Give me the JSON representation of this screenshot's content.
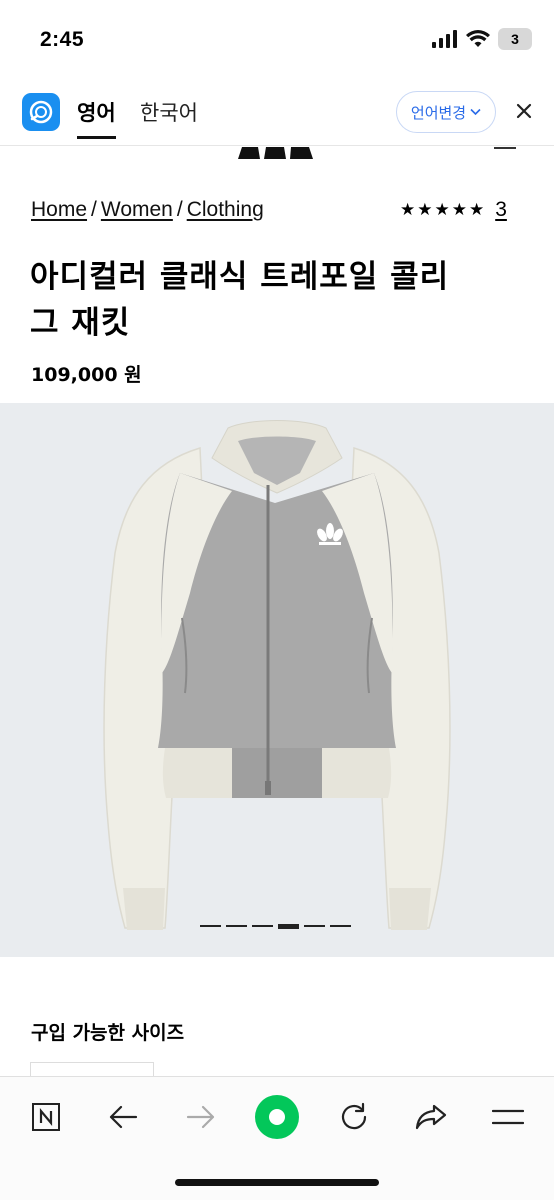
{
  "status_bar": {
    "time": "2:45",
    "battery": "3"
  },
  "translate_bar": {
    "source_lang": "영어",
    "target_lang": "한국어",
    "change_label": "언어변경",
    "accent_color": "#1a8ff0"
  },
  "breadcrumb": {
    "items": [
      "Home",
      "Women",
      "Clothing"
    ],
    "separator": "/"
  },
  "rating": {
    "stars": "★★★★★",
    "count": "3"
  },
  "product": {
    "title": "아디컬러 클래식 트레포일 콜리그 재킷",
    "price": "109,000 원"
  },
  "carousel": {
    "total": 6,
    "active_index": 3
  },
  "sizes": {
    "heading": "구입 가능한 사이즈"
  },
  "bottom_nav": {
    "icons": [
      "naver-n-icon",
      "back-arrow-icon",
      "forward-arrow-icon",
      "green-dot-icon",
      "refresh-icon",
      "share-icon",
      "menu-icon"
    ],
    "green_color": "#03c75a"
  }
}
